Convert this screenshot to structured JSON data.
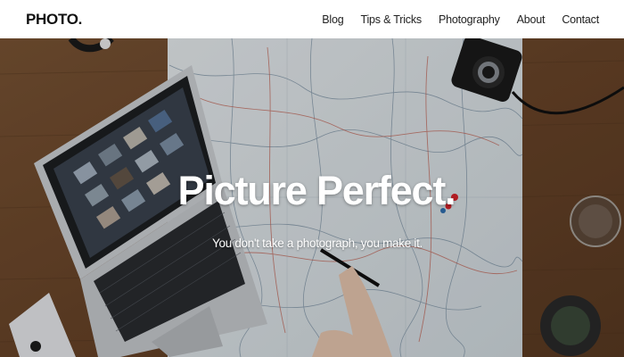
{
  "header": {
    "logo": "PHOTO.",
    "nav": [
      {
        "label": "Blog"
      },
      {
        "label": "Tips & Tricks"
      },
      {
        "label": "Photography"
      },
      {
        "label": "About"
      },
      {
        "label": "Contact"
      }
    ]
  },
  "hero": {
    "title": "Picture Perfect.",
    "subtitle": "You don't take a photograph, you make it.",
    "image_subject": "desk-with-map-laptop-camera"
  },
  "colors": {
    "header_bg": "#ffffff",
    "text_dark": "#222222",
    "wood": "#6b4a2e",
    "map": "#dfe6ea"
  }
}
